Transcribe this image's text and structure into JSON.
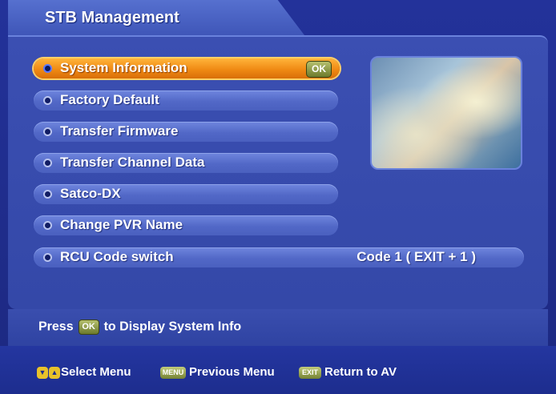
{
  "header": {
    "title": "STB Management"
  },
  "menu": {
    "items": [
      {
        "label": "System Information",
        "selected": true,
        "badge": "OK"
      },
      {
        "label": "Factory Default"
      },
      {
        "label": "Transfer Firmware"
      },
      {
        "label": "Transfer Channel Data"
      },
      {
        "label": "Satco-DX"
      },
      {
        "label": "Change PVR Name"
      },
      {
        "label": "RCU Code switch",
        "value": "Code 1 ( EXIT + 1 )"
      }
    ]
  },
  "status": {
    "prefix": "Press",
    "key": "OK",
    "suffix": "to Display System Info"
  },
  "footer": {
    "select_label": "Select Menu",
    "menu_key": "MENU",
    "previous_label": "Previous Menu",
    "exit_key": "EXIT",
    "return_label": "Return to AV"
  },
  "colors": {
    "background": "#1f2c8c",
    "selected": "#f08a14",
    "item": "#5268c7"
  }
}
